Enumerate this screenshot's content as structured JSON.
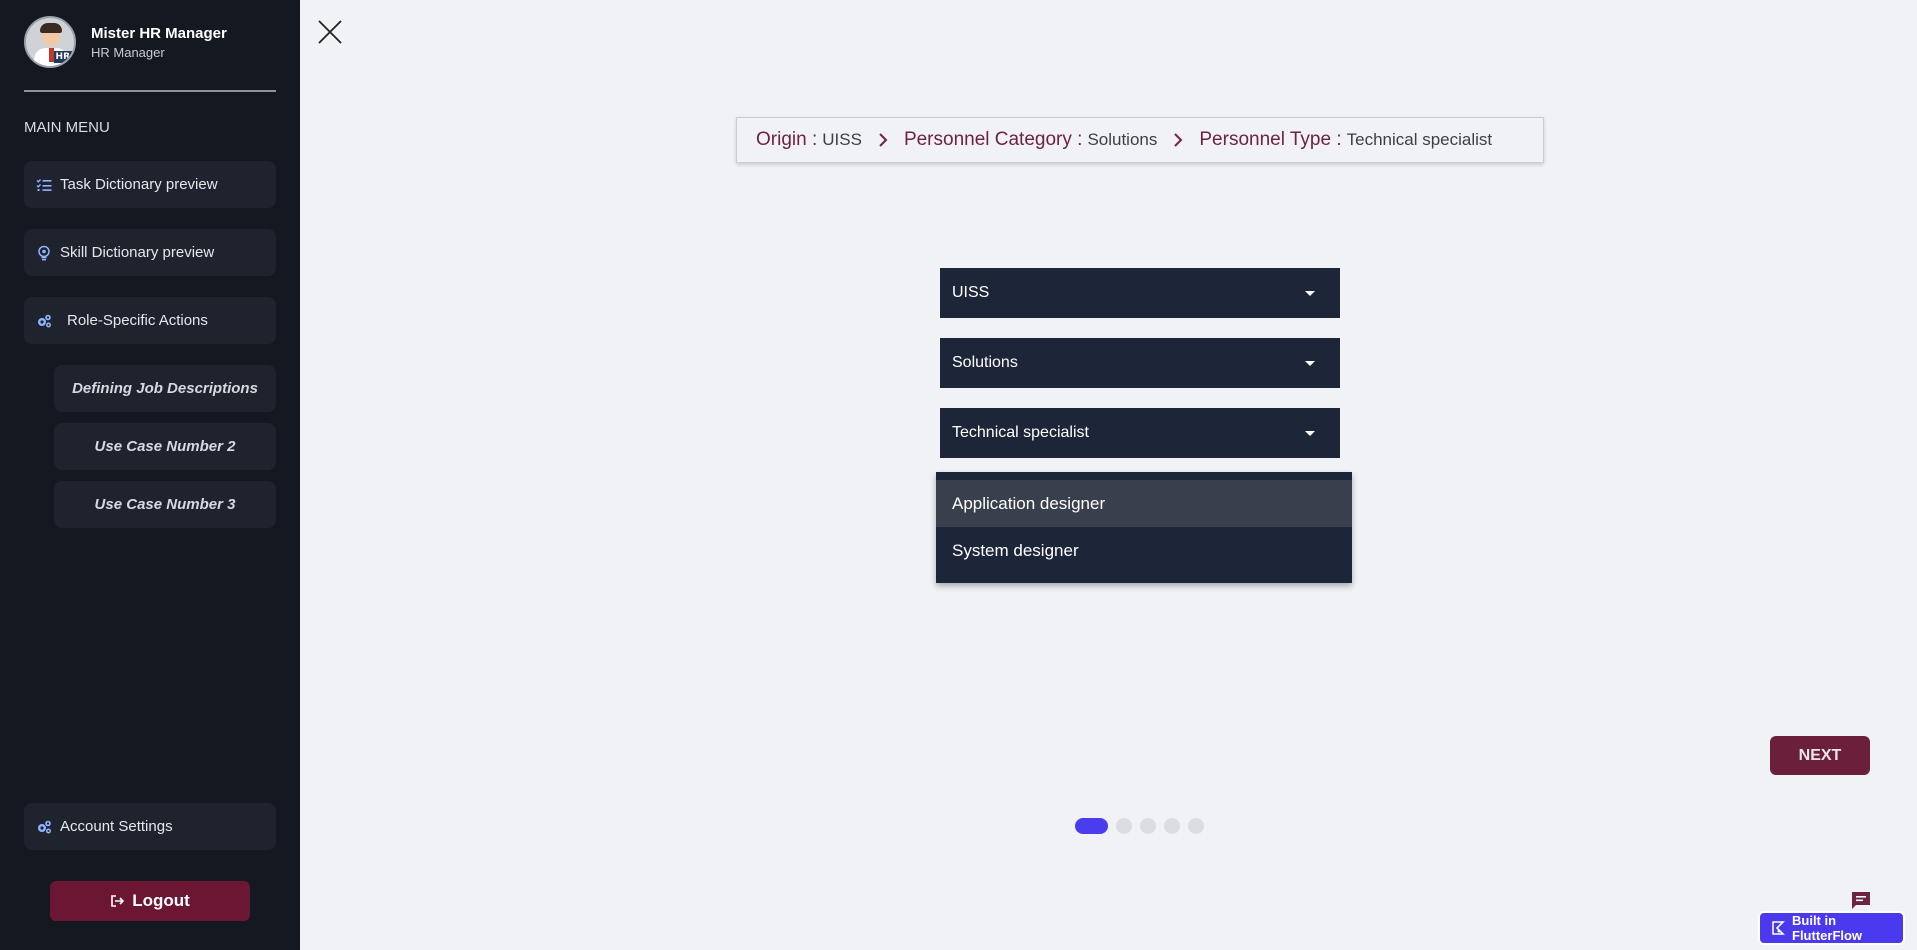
{
  "profile": {
    "name": "Mister HR Manager",
    "role": "HR Manager"
  },
  "sidebar": {
    "heading": "MAIN MENU",
    "items": [
      {
        "label": "Task Dictionary preview",
        "icon": "checklist-icon"
      },
      {
        "label": "Skill Dictionary preview",
        "icon": "lightbulb-gear-icon"
      },
      {
        "label": "Role-Specific Actions",
        "icon": "gears-icon"
      }
    ],
    "sub_items": [
      {
        "label": "Defining Job Descriptions"
      },
      {
        "label": "Use Case Number 2"
      },
      {
        "label": "Use Case Number 3"
      }
    ],
    "account_settings": {
      "label": "Account Settings",
      "icon": "gears-icon"
    },
    "logout_label": "Logout"
  },
  "breadcrumb": {
    "origin_key": "Origin :",
    "origin_value": "UISS",
    "category_key": "Personnel Category :",
    "category_value": "Solutions",
    "type_key": "Personnel Type :",
    "type_value": "Technical specialist"
  },
  "dropdowns": {
    "origin": "UISS",
    "category": "Solutions",
    "type": "Technical specialist"
  },
  "options": [
    "Application designer",
    "System designer"
  ],
  "next_label": "NEXT",
  "pagination": {
    "total": 5,
    "current": 1
  },
  "badge": {
    "label": "Built in FlutterFlow"
  },
  "colors": {
    "sidebar_bg": "#141820",
    "accent_maroon": "#6d2342",
    "dropdown_bg": "#1d2638",
    "page_indicator": "#4a3df0",
    "flutterflow": "#4b39ef"
  }
}
